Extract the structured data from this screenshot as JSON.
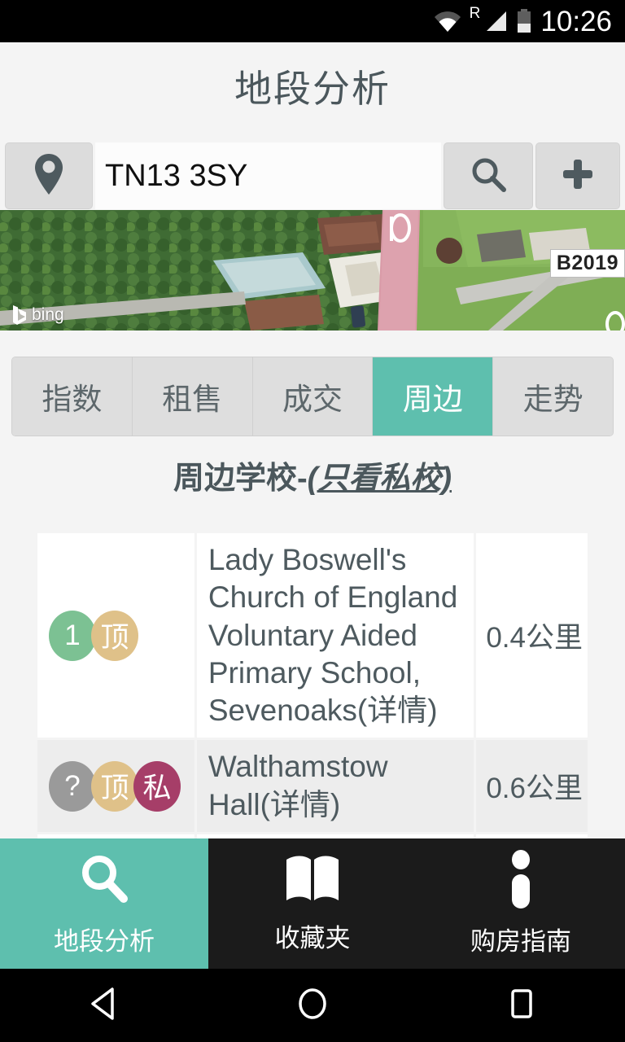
{
  "status_bar": {
    "wifi_icon": "wifi-icon",
    "roaming_label": "R",
    "signal_icon": "signal-icon",
    "battery_icon": "battery-icon",
    "time": "10:26"
  },
  "header": {
    "title": "地段分析"
  },
  "search": {
    "location_icon": "location-pin-icon",
    "postcode_value": "TN13 3SY",
    "postcode_placeholder": "TN13 3SY",
    "search_icon": "search-icon",
    "add_icon": "plus-icon"
  },
  "map": {
    "attribution": "bing",
    "road_label": "B2019"
  },
  "tabs": {
    "items": [
      {
        "label": "指数",
        "active": false
      },
      {
        "label": "租售",
        "active": false
      },
      {
        "label": "成交",
        "active": false
      },
      {
        "label": "周边",
        "active": true
      },
      {
        "label": "走势",
        "active": false
      }
    ]
  },
  "section": {
    "heading": "周边学校-",
    "link": "(只看私校)"
  },
  "schools": {
    "rows": [
      {
        "badges": [
          {
            "text": "1",
            "color": "#7cc193"
          },
          {
            "text": "顶",
            "color": "#dfc189"
          }
        ],
        "name": "Lady Boswell's Church of England Voluntary Aided Primary School, Sevenoaks(详情)",
        "distance": "0.4公里"
      },
      {
        "badges": [
          {
            "text": "?",
            "color": "#9a9a9a"
          },
          {
            "text": "顶",
            "color": "#dfc189"
          },
          {
            "text": "私",
            "color": "#a63e68"
          }
        ],
        "name": "Walthamstow Hall(详情)",
        "distance": "0.6公里"
      },
      {
        "badges": [],
        "name": "",
        "distance": ""
      }
    ]
  },
  "bottom_nav": {
    "items": [
      {
        "label": "地段分析",
        "icon": "search-icon",
        "active": true
      },
      {
        "label": "收藏夹",
        "icon": "book-icon",
        "active": false
      },
      {
        "label": "购房指南",
        "icon": "info-icon",
        "active": false
      }
    ]
  },
  "android_nav": {
    "back_icon": "back-triangle-icon",
    "home_icon": "home-circle-icon",
    "recents_icon": "recents-square-icon"
  },
  "colors": {
    "accent_teal": "#5ebfae",
    "page_bg": "#f4f4f4",
    "text_dark": "#4b575c"
  }
}
